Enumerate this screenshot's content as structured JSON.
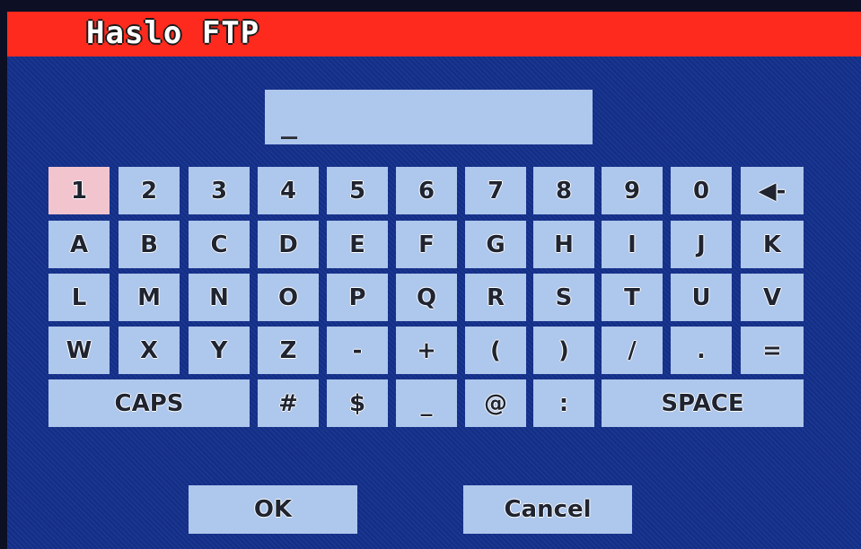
{
  "dialog": {
    "title": "Haslo FTP",
    "input_value": "_"
  },
  "keyboard": {
    "row1": [
      "1",
      "2",
      "3",
      "4",
      "5",
      "6",
      "7",
      "8",
      "9",
      "0",
      "◀-"
    ],
    "row2": [
      "A",
      "B",
      "C",
      "D",
      "E",
      "F",
      "G",
      "H",
      "I",
      "J",
      "K"
    ],
    "row3": [
      "L",
      "M",
      "N",
      "O",
      "P",
      "Q",
      "R",
      "S",
      "T",
      "U",
      "V"
    ],
    "row4": [
      "W",
      "X",
      "Y",
      "Z",
      "-",
      "+",
      "(",
      ")",
      "/",
      ".",
      "="
    ],
    "row5": {
      "caps": "CAPS",
      "hash": "#",
      "dollar": "$",
      "underscore": "_",
      "at": "@",
      "colon": ":",
      "space": "SPACE"
    },
    "selected_key": "1"
  },
  "buttons": {
    "ok": "OK",
    "cancel": "Cancel"
  },
  "colors": {
    "background": "#14308a",
    "title_bar": "#ff2a1e",
    "key": "#aec7ec",
    "selected_key": "#f2c4ce"
  }
}
